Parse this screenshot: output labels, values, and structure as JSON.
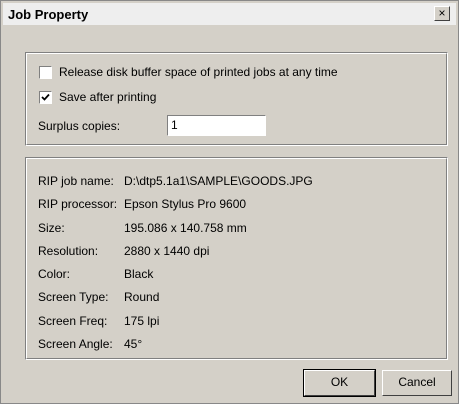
{
  "window": {
    "title": "Job Property",
    "close_glyph": "×"
  },
  "options": {
    "release_buffer_label": "Release disk buffer space of printed jobs at any time",
    "release_buffer_checked": false,
    "save_after_label": "Save after printing",
    "save_after_checked": true,
    "surplus_label": "Surplus copies:",
    "surplus_value": "1"
  },
  "info": [
    {
      "key": "RIP job name:",
      "value": "D:\\dtp5.1a1\\SAMPLE\\GOODS.JPG"
    },
    {
      "key": "RIP processor:",
      "value": "Epson Stylus Pro 9600"
    },
    {
      "key": "Size:",
      "value": "195.086 x 140.758 mm"
    },
    {
      "key": "Resolution:",
      "value": "2880 x 1440 dpi"
    },
    {
      "key": "Color:",
      "value": "Black"
    },
    {
      "key": "Screen Type:",
      "value": "Round"
    },
    {
      "key": "Screen Freq:",
      "value": "175 lpi"
    },
    {
      "key": "Screen Angle:",
      "value": "45°"
    }
  ],
  "buttons": {
    "ok": "OK",
    "cancel": "Cancel"
  }
}
